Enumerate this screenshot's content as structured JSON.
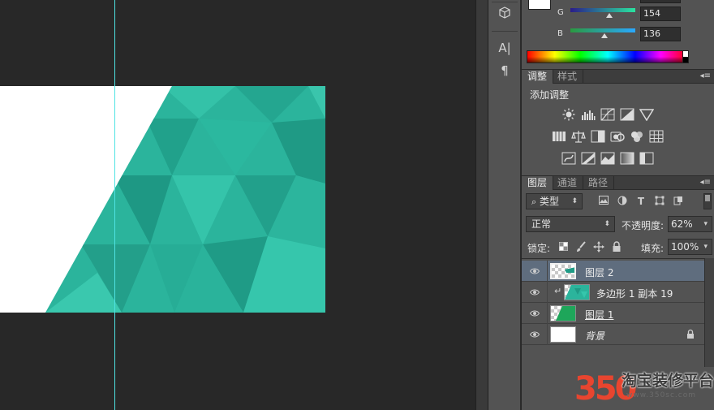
{
  "colors": {
    "teal": "#2bb79e",
    "guide": "#4fe3e3",
    "panel_bg": "#535353",
    "selected_row": "#5f6d7e"
  },
  "tool_strip": {
    "icons": [
      "3d-cube-icon",
      "character-icon",
      "paragraph-icon"
    ],
    "character_glyph": "A|",
    "paragraph_glyph": "¶"
  },
  "color_panel": {
    "g_label": "G",
    "g_value": "154",
    "b_label": "B",
    "b_value": "136"
  },
  "adjustments_panel": {
    "tabs": [
      "调整",
      "样式"
    ],
    "title": "添加调整"
  },
  "layers_panel": {
    "tabs": [
      "图层",
      "通道",
      "路径"
    ],
    "filter_label": "类型",
    "blend_mode": "正常",
    "opacity_label": "不透明度:",
    "opacity_value": "62%",
    "lock_label": "锁定:",
    "fill_label": "填充:",
    "fill_value": "100%",
    "layers": [
      {
        "name": "图层 2",
        "selected": true
      },
      {
        "name": "多边形 1 副本 19",
        "clipped": true
      },
      {
        "name": "图层 1"
      },
      {
        "name": "背景",
        "locked": true
      }
    ]
  },
  "watermark": {
    "number": "350",
    "text": "淘宝装修平台",
    "url": "www.350sc.com"
  }
}
